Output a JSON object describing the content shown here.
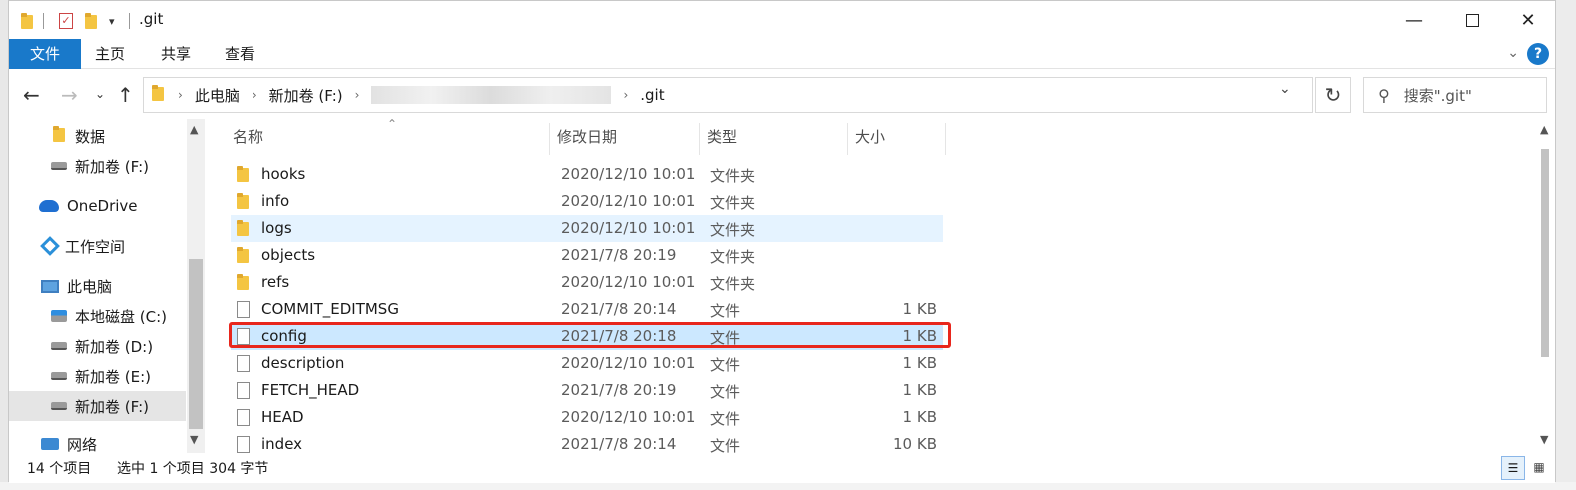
{
  "title": ".git",
  "ribbon": {
    "tabs": [
      "文件",
      "主页",
      "共享",
      "查看"
    ],
    "help": "?"
  },
  "address": {
    "crumbs": [
      "此电脑",
      "新加卷 (F:)",
      ".git"
    ]
  },
  "search": {
    "placeholder": "搜索\".git\""
  },
  "nav": {
    "items": [
      {
        "label": "数据",
        "icon": "folder-icon"
      },
      {
        "label": "新加卷 (F:)",
        "icon": "drive-icon"
      },
      {
        "label": "OneDrive",
        "icon": "cloud-icon"
      },
      {
        "label": "工作空间",
        "icon": "workspace-icon"
      },
      {
        "label": "此电脑",
        "icon": "computer-icon"
      },
      {
        "label": "本地磁盘 (C:)",
        "icon": "system-drive-icon"
      },
      {
        "label": "新加卷 (D:)",
        "icon": "drive-icon"
      },
      {
        "label": "新加卷 (E:)",
        "icon": "drive-icon"
      },
      {
        "label": "新加卷 (F:)",
        "icon": "drive-icon"
      },
      {
        "label": "网络",
        "icon": "network-icon"
      }
    ]
  },
  "columns": {
    "name": "名称",
    "date": "修改日期",
    "type": "类型",
    "size": "大小"
  },
  "files": [
    {
      "name": "hooks",
      "date": "2020/12/10 10:01",
      "type": "文件夹",
      "size": ""
    },
    {
      "name": "info",
      "date": "2020/12/10 10:01",
      "type": "文件夹",
      "size": ""
    },
    {
      "name": "logs",
      "date": "2020/12/10 10:01",
      "type": "文件夹",
      "size": ""
    },
    {
      "name": "objects",
      "date": "2021/7/8 20:19",
      "type": "文件夹",
      "size": ""
    },
    {
      "name": "refs",
      "date": "2020/12/10 10:01",
      "type": "文件夹",
      "size": ""
    },
    {
      "name": "COMMIT_EDITMSG",
      "date": "2021/7/8 20:14",
      "type": "文件",
      "size": "1 KB"
    },
    {
      "name": "config",
      "date": "2021/7/8 20:18",
      "type": "文件",
      "size": "1 KB"
    },
    {
      "name": "description",
      "date": "2020/12/10 10:01",
      "type": "文件",
      "size": "1 KB"
    },
    {
      "name": "FETCH_HEAD",
      "date": "2021/7/8 20:19",
      "type": "文件",
      "size": "1 KB"
    },
    {
      "name": "HEAD",
      "date": "2020/12/10 10:01",
      "type": "文件",
      "size": "1 KB"
    },
    {
      "name": "index",
      "date": "2021/7/8 20:14",
      "type": "文件",
      "size": "10 KB"
    }
  ],
  "status": {
    "count": "14 个项目",
    "selection": "选中 1 个项目  304 字节"
  },
  "colors": {
    "accent": "#1979ca",
    "selected_row": "#cce8ff",
    "hover_row": "#e5f3ff",
    "highlight": "#e8271d"
  }
}
